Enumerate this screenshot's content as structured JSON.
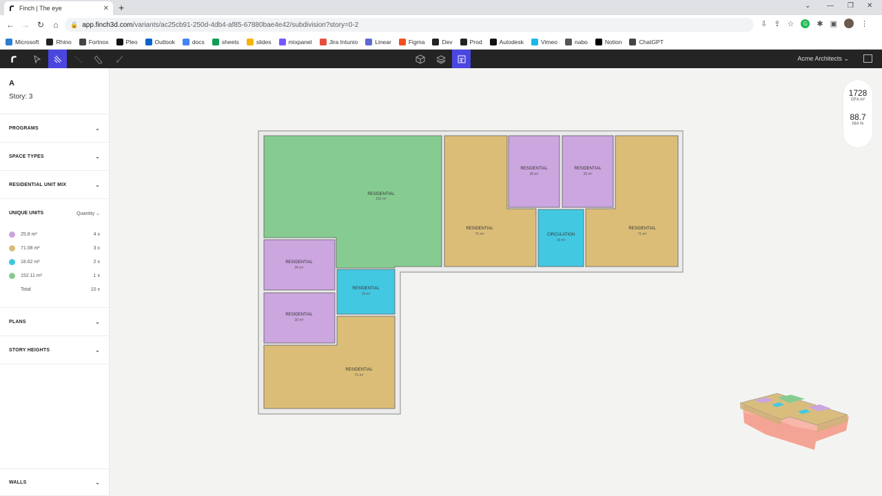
{
  "browser": {
    "tab_title": "Finch | The eye",
    "url_host": "app.finch3d.com",
    "url_path": "/variants/ac25cb91-250d-4db4-af85-67880bae4e42/subdivision?story=0-2",
    "bookmarks": [
      {
        "label": "Microsoft",
        "color": "#2b7cd3"
      },
      {
        "label": "Rhino",
        "color": "#222222"
      },
      {
        "label": "Fortnox",
        "color": "#444444"
      },
      {
        "label": "Pleo",
        "color": "#111111"
      },
      {
        "label": "Outlook",
        "color": "#0a64c8"
      },
      {
        "label": "docs",
        "color": "#4285f4"
      },
      {
        "label": "sheets",
        "color": "#0f9d58"
      },
      {
        "label": "slides",
        "color": "#f4b400"
      },
      {
        "label": "mixpanel",
        "color": "#7856ff"
      },
      {
        "label": "Jira Intunio",
        "color": "#e74c3c"
      },
      {
        "label": "Linear",
        "color": "#5e6ad2"
      },
      {
        "label": "Figma",
        "color": "#f24e1e"
      },
      {
        "label": "Dev",
        "color": "#222222"
      },
      {
        "label": "Prod",
        "color": "#222222"
      },
      {
        "label": "Autodesk",
        "color": "#111111"
      },
      {
        "label": "Vimeo",
        "color": "#1ab7ea"
      },
      {
        "label": "nabo",
        "color": "#555555"
      },
      {
        "label": "Notion",
        "color": "#000000"
      },
      {
        "label": "ChatGPT",
        "color": "#444444"
      }
    ]
  },
  "app": {
    "org": "Acme Architects",
    "accent": "#4a46e0"
  },
  "sidebar": {
    "name": "A",
    "story": "Story: 3",
    "sections": {
      "programs": "PROGRAMS",
      "space_types": "SPACE TYPES",
      "unit_mix": "RESIDENTIAL UNIT MIX",
      "plans": "PLANS",
      "story_heights": "STORY HEIGHTS",
      "walls": "WALLS"
    },
    "unique_units": {
      "title": "UNIQUE UNITS",
      "sort": "Quantity",
      "rows": [
        {
          "area": "25.8 m²",
          "qty": "4 x",
          "color": "#c9a3de"
        },
        {
          "area": "71.08 m²",
          "qty": "3 x",
          "color": "#d9bb79"
        },
        {
          "area": "18.62 m²",
          "qty": "2 x",
          "color": "#3fc6de"
        },
        {
          "area": "152.11 m²",
          "qty": "1 x",
          "color": "#86c98f"
        }
      ],
      "total_label": "Total",
      "total_qty": "10 x"
    }
  },
  "metrics": {
    "gfa_value": "1728",
    "gfa_label": "GFA m²",
    "nia_value": "88.7",
    "nia_label": "NIA %"
  },
  "rooms": {
    "green": {
      "label": "RESIDENTIAL",
      "area": "152 m²",
      "color": "#86cc91"
    },
    "tan1": {
      "label": "RESIDENTIAL",
      "area": "71 m²",
      "color": "#dbbd78"
    },
    "tan2": {
      "label": "RESIDENTIAL",
      "area": "71 m²",
      "color": "#dbbd78"
    },
    "tan3": {
      "label": "RESIDENTIAL",
      "area": "71 m²",
      "color": "#dbbd78"
    },
    "lilac1": {
      "label": "RESIDENTIAL",
      "area": "26 m²",
      "color": "#cba6df"
    },
    "lilac2": {
      "label": "RESIDENTIAL",
      "area": "26 m²",
      "color": "#cba6df"
    },
    "lilac3": {
      "label": "RESIDENTIAL",
      "area": "26 m²",
      "color": "#cba6df"
    },
    "lilac4": {
      "label": "RESIDENTIAL",
      "area": "26 m²",
      "color": "#cba6df"
    },
    "circ1": {
      "label": "CIRCULATION",
      "area": "19 m²",
      "color": "#43c8e2"
    },
    "circ2": {
      "label": "RESIDENTIAL",
      "area": "19 m²",
      "color": "#43c8e2"
    }
  }
}
